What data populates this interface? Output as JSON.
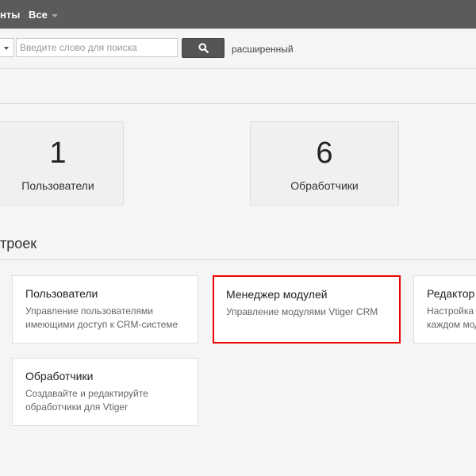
{
  "topbar": {
    "nav_partial": "нты",
    "filter_label": "Все"
  },
  "search": {
    "placeholder": "Введите слово для поиска",
    "value": "",
    "button_icon": "search-icon",
    "advanced_label": "расширенный"
  },
  "stats": [
    {
      "number": "1",
      "label": "Пользователи"
    },
    {
      "number": "6",
      "label": "Обработчики"
    }
  ],
  "section": {
    "title": "троек"
  },
  "tiles": [
    {
      "title": "Пользователи",
      "desc_line1": "Управление пользователями",
      "desc_line2": "имеющими доступ к CRM-системе"
    },
    {
      "title": "Менеджер модулей",
      "desc_line1": "Управление модулями Vtiger CRM",
      "desc_line2": ""
    },
    {
      "title": "Редактор",
      "desc_line1": "Настройка з",
      "desc_line2": "каждом мод"
    },
    {
      "title": "Обработчики",
      "desc_line1": "Создавайте и редактируйте",
      "desc_line2": "обработчики для Vtiger"
    }
  ],
  "colors": {
    "topbar_bg": "#5b5b5b",
    "highlight_border": "#e00000",
    "search_button_bg": "#555555"
  }
}
